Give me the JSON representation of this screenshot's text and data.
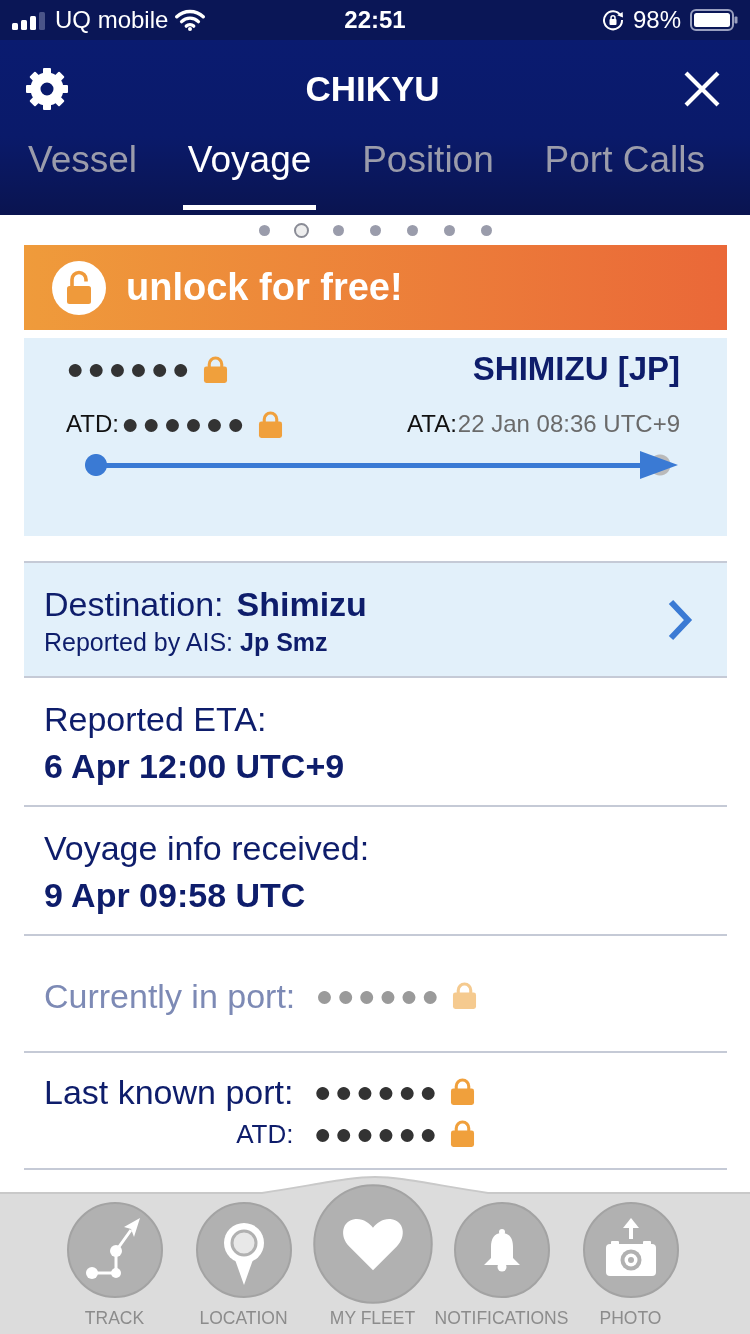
{
  "status_bar": {
    "carrier": "UQ mobile",
    "time": "22:51",
    "battery": "98%"
  },
  "header": {
    "title": "CHIKYU"
  },
  "tabs": [
    {
      "label": "Vessel",
      "selected": false
    },
    {
      "label": "Voyage",
      "selected": true
    },
    {
      "label": "Position",
      "selected": false
    },
    {
      "label": "Port Calls",
      "selected": false
    }
  ],
  "page_dots": [
    {
      "selected": false
    },
    {
      "selected": true
    },
    {
      "selected": false
    },
    {
      "selected": false
    },
    {
      "selected": false
    },
    {
      "selected": false
    },
    {
      "selected": false
    }
  ],
  "unlock_banner": {
    "label": "unlock for free!"
  },
  "voyage_card": {
    "departure": {
      "value": "●●●●●●",
      "locked": true
    },
    "arrival": {
      "value": "SHIMIZU [JP]"
    },
    "atd": {
      "label": "ATD:",
      "value": "●●●●●●",
      "locked": true
    },
    "ata": {
      "label": "ATA:",
      "value": "22 Jan 08:36 UTC+9"
    },
    "progress": {
      "level": 1
    }
  },
  "destination": {
    "label": "Destination:",
    "value": "Shimizu",
    "ais_label": "Reported by AIS:",
    "ais_value": "Jp Smz"
  },
  "info_rows": [
    {
      "kind": "stacked",
      "disabled": false,
      "label": "Reported ETA:",
      "value": "6 Apr 12:00 UTC+9"
    },
    {
      "kind": "stacked",
      "disabled": false,
      "label": "Voyage info received:",
      "value": "9 Apr 09:58 UTC"
    },
    {
      "kind": "locked",
      "disabled": true,
      "lines": [
        {
          "label": "Currently in port:",
          "value": "●●●●●●",
          "locked": true
        }
      ]
    },
    {
      "kind": "locked",
      "disabled": false,
      "lines": [
        {
          "label": "Last known port:",
          "value": "●●●●●●",
          "locked": true
        },
        {
          "label": "ATD:",
          "value": "●●●●●●",
          "locked": true
        }
      ]
    }
  ],
  "nav_items": [
    {
      "label": "TRACK",
      "kind": "standard"
    },
    {
      "label": "LOCATION",
      "kind": "standard"
    },
    {
      "label": "MY FLEET",
      "kind": "featured"
    },
    {
      "label": "NOTIFICATIONS",
      "kind": "standard"
    },
    {
      "label": "PHOTO",
      "kind": "standard"
    }
  ]
}
